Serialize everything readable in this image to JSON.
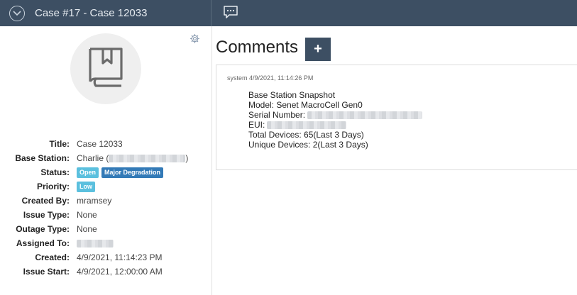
{
  "header": {
    "title": "Case #17 - Case 12033"
  },
  "details": [
    {
      "label": "Title:",
      "value": "Case 12033"
    },
    {
      "label": "Base Station:",
      "value_prefix": "Charlie (",
      "value_suffix": ")"
    },
    {
      "label": "Status:",
      "badges": [
        "Open",
        "Major Degradation"
      ]
    },
    {
      "label": "Priority:",
      "badges": [
        "Low"
      ]
    },
    {
      "label": "Created By:",
      "value": "mramsey"
    },
    {
      "label": "Issue Type:",
      "value": "None"
    },
    {
      "label": "Outage Type:",
      "value": "None"
    },
    {
      "label": "Assigned To:"
    },
    {
      "label": "Created:",
      "value": "4/9/2021, 11:14:23 PM"
    },
    {
      "label": "Issue Start:",
      "value": "4/9/2021, 12:00:00 AM"
    }
  ],
  "comments_section": {
    "title": "Comments",
    "add_label": "+"
  },
  "comments": [
    {
      "meta": "system 4/9/2021, 11:14:26 PM",
      "lines": [
        "Base Station Snapshot",
        "Model: Senet MacroCell Gen0",
        "Serial Number:",
        "EUI:",
        "Total Devices: 65(Last 3 Days)",
        "Unique Devices: 2(Last 3 Days)"
      ]
    }
  ],
  "colors": {
    "header_bg": "#3d4f63",
    "badge_info": "#5bc0de",
    "badge_primary": "#337ab7"
  },
  "icons": [
    "chevron-down-circle-icon",
    "chat-icon",
    "gear-icon",
    "book-icon"
  ]
}
